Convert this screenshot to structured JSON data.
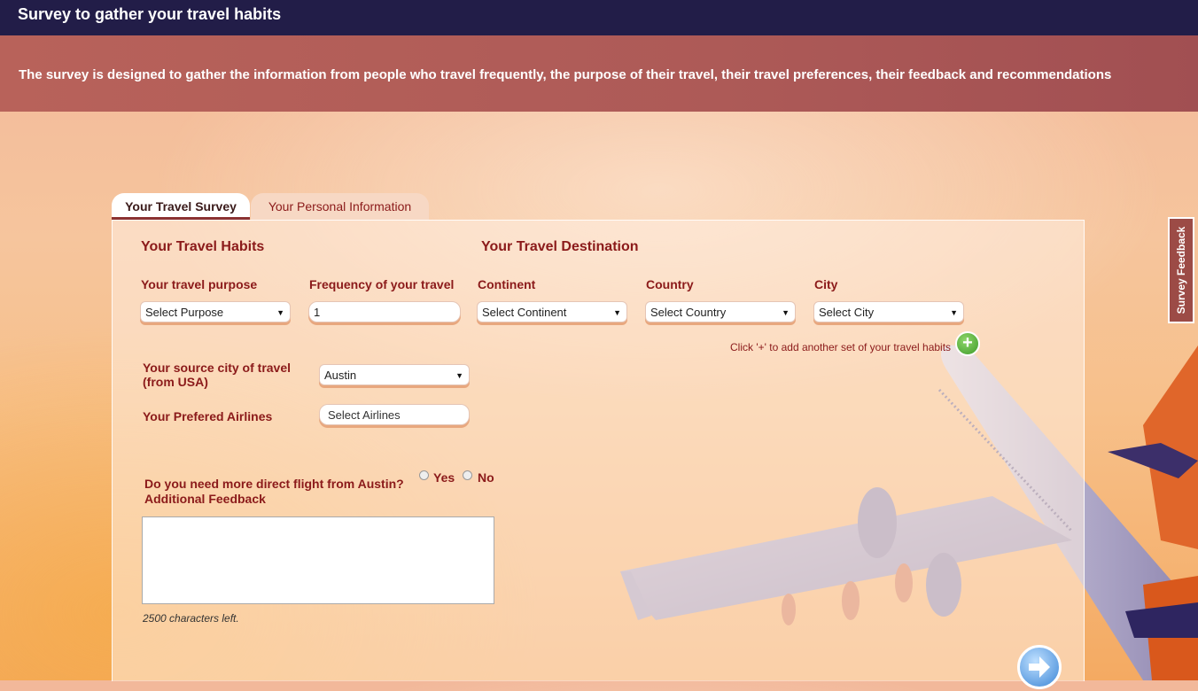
{
  "header": {
    "title": "Survey to gather your travel habits"
  },
  "banner": {
    "text": "The survey is designed to gather the information from people who travel frequently, the purpose of their travel, their travel preferences, their feedback and recommendations"
  },
  "tabs": [
    {
      "label": "Your Travel Survey",
      "active": true
    },
    {
      "label": "Your Personal Information",
      "active": false
    }
  ],
  "habits": {
    "title": "Your Travel Habits",
    "purpose_label": "Your travel purpose",
    "purpose_value": "Select Purpose",
    "frequency_label": "Frequency of your travel",
    "frequency_value": "1",
    "source_label_line1": "Your source city of travel",
    "source_label_line2": "(from USA)",
    "source_value": "Austin",
    "airlines_label": "Your Prefered Airlines",
    "airlines_placeholder": "Select Airlines",
    "direct_flight_question": "Do you need more direct flight from  Austin?",
    "yes_label": "Yes",
    "no_label": "No",
    "additional_feedback_label": "Additional Feedback",
    "chars_left": "2500 characters left."
  },
  "destination": {
    "title": "Your Travel Destination",
    "continent_label": "Continent",
    "continent_value": "Select Continent",
    "country_label": "Country",
    "country_value": "Select Country",
    "city_label": "City",
    "city_value": "Select City",
    "add_note": "Click '+' to add another set of your travel habits",
    "add_symbol": "+"
  },
  "side": {
    "feedback_label": "Survey Feedback"
  },
  "colors": {
    "topbar": "#221d48",
    "banner": "#ad5a57",
    "label": "#8b1a1a",
    "field_shadow": "#e8a77e"
  }
}
